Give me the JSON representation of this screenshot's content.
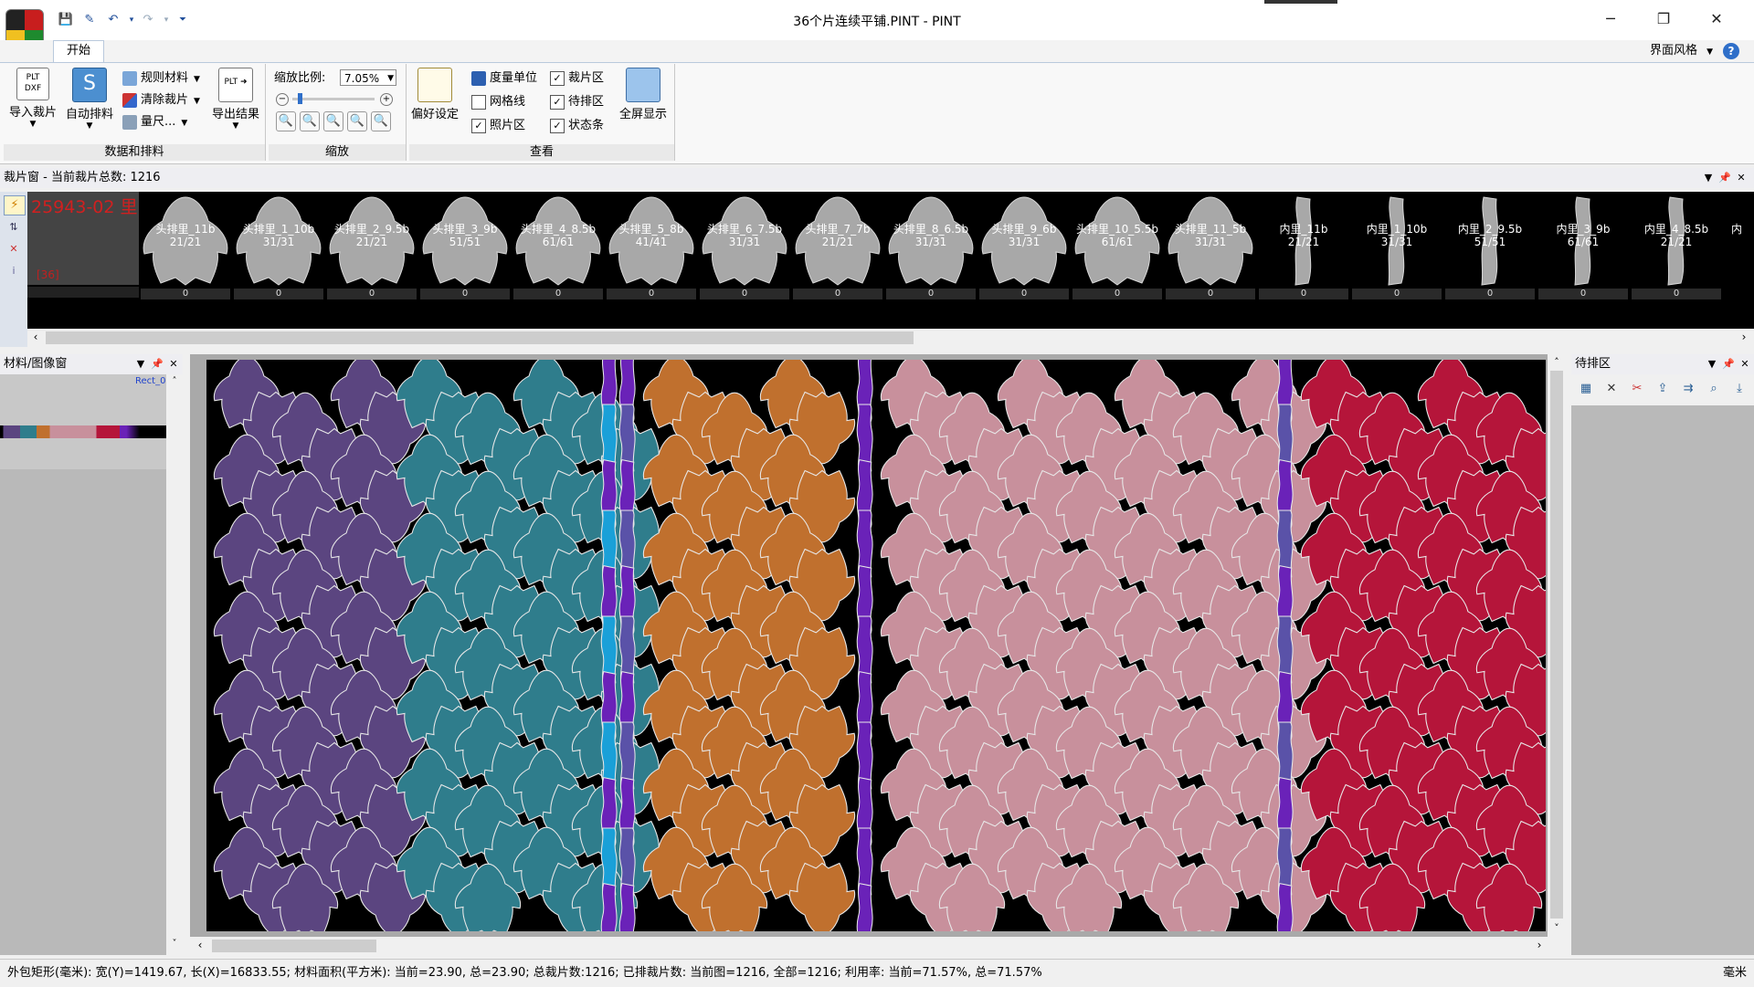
{
  "window": {
    "title": "36个片连续平铺.PINT - PINT",
    "minimize": "─",
    "restore": "❐",
    "close": "✕"
  },
  "ribbon": {
    "tab_start": "开始",
    "style_menu": "界面风格",
    "help": "?",
    "groups": {
      "data": {
        "name": "数据和排料",
        "import": "导入裁片",
        "auto": "自动排料",
        "rule_material": "规则材料",
        "clear_pieces": "清除裁片",
        "measure": "量尺...",
        "export": "导出结果"
      },
      "zoom": {
        "name": "缩放",
        "scale_label": "缩放比例:",
        "scale_value": "7.05%"
      },
      "view": {
        "name": "查看",
        "preferences": "偏好设定",
        "unit": "度量单位",
        "grid": "网格线",
        "photo_area": "照片区",
        "piece_area": "裁片区",
        "pending_area": "待排区",
        "statusbar": "状态条",
        "fullscreen": "全屏显示"
      }
    }
  },
  "piece_window": {
    "title": "裁片窗 - 当前裁片总数: 1216",
    "order_code": "25943-02 里",
    "order_count": "[36]",
    "pieces": [
      {
        "name": "头排里_11b",
        "count": "21/21",
        "qty": "0",
        "shape": "head"
      },
      {
        "name": "头排里_1_10b",
        "count": "31/31",
        "qty": "0",
        "shape": "head"
      },
      {
        "name": "头排里_2_9.5b",
        "count": "21/21",
        "qty": "0",
        "shape": "head"
      },
      {
        "name": "头排里_3_9b",
        "count": "51/51",
        "qty": "0",
        "shape": "head"
      },
      {
        "name": "头排里_4_8.5b",
        "count": "61/61",
        "qty": "0",
        "shape": "head"
      },
      {
        "name": "头排里_5_8b",
        "count": "41/41",
        "qty": "0",
        "shape": "head"
      },
      {
        "name": "头排里_6_7.5b",
        "count": "31/31",
        "qty": "0",
        "shape": "head"
      },
      {
        "name": "头排里_7_7b",
        "count": "21/21",
        "qty": "0",
        "shape": "head"
      },
      {
        "name": "头排里_8_6.5b",
        "count": "31/31",
        "qty": "0",
        "shape": "head"
      },
      {
        "name": "头排里_9_6b",
        "count": "31/31",
        "qty": "0",
        "shape": "head"
      },
      {
        "name": "头排里_10_5.5b",
        "count": "61/61",
        "qty": "0",
        "shape": "head"
      },
      {
        "name": "头排里_11_5b",
        "count": "31/31",
        "qty": "0",
        "shape": "head"
      },
      {
        "name": "内里_11b",
        "count": "21/21",
        "qty": "0",
        "shape": "strip"
      },
      {
        "name": "内里_1_10b",
        "count": "31/31",
        "qty": "0",
        "shape": "strip"
      },
      {
        "name": "内里_2_9.5b",
        "count": "51/51",
        "qty": "0",
        "shape": "strip"
      },
      {
        "name": "内里_3_9b",
        "count": "61/61",
        "qty": "0",
        "shape": "strip"
      },
      {
        "name": "内里_4_8.5b",
        "count": "21/21",
        "qty": "0",
        "shape": "strip"
      }
    ],
    "last_partial": "内"
  },
  "material_window": {
    "title": "材料/图像窗",
    "rect_label": "Rect_0"
  },
  "pending_window": {
    "title": "待排区"
  },
  "colors": {
    "purple": "#5b4580",
    "teal": "#2f7d8c",
    "orange": "#c0702e",
    "pink": "#c8909c",
    "red": "#b5153a",
    "violet": "#6a22b8",
    "slate": "#5a52a8",
    "cyan": "#1aa0d8",
    "gray_piece": "#a8a8a8"
  },
  "layout_columns": [
    {
      "color": "purple",
      "pieces": 14
    },
    {
      "color": "teal",
      "pieces": 20
    },
    {
      "color": "orange",
      "pieces": 18
    },
    {
      "color": "pink",
      "pieces": 36
    },
    {
      "color": "red",
      "pieces": 18
    }
  ],
  "statusbar": {
    "text": "外包矩形(毫米): 宽(Y)=1419.67, 长(X)=16833.55; 材料面积(平方米): 当前=23.90, 总=23.90; 总裁片数:1216; 已排裁片数: 当前图=1216, 全部=1216; 利用率: 当前=71.57%, 总=71.57%",
    "unit": "毫米"
  }
}
